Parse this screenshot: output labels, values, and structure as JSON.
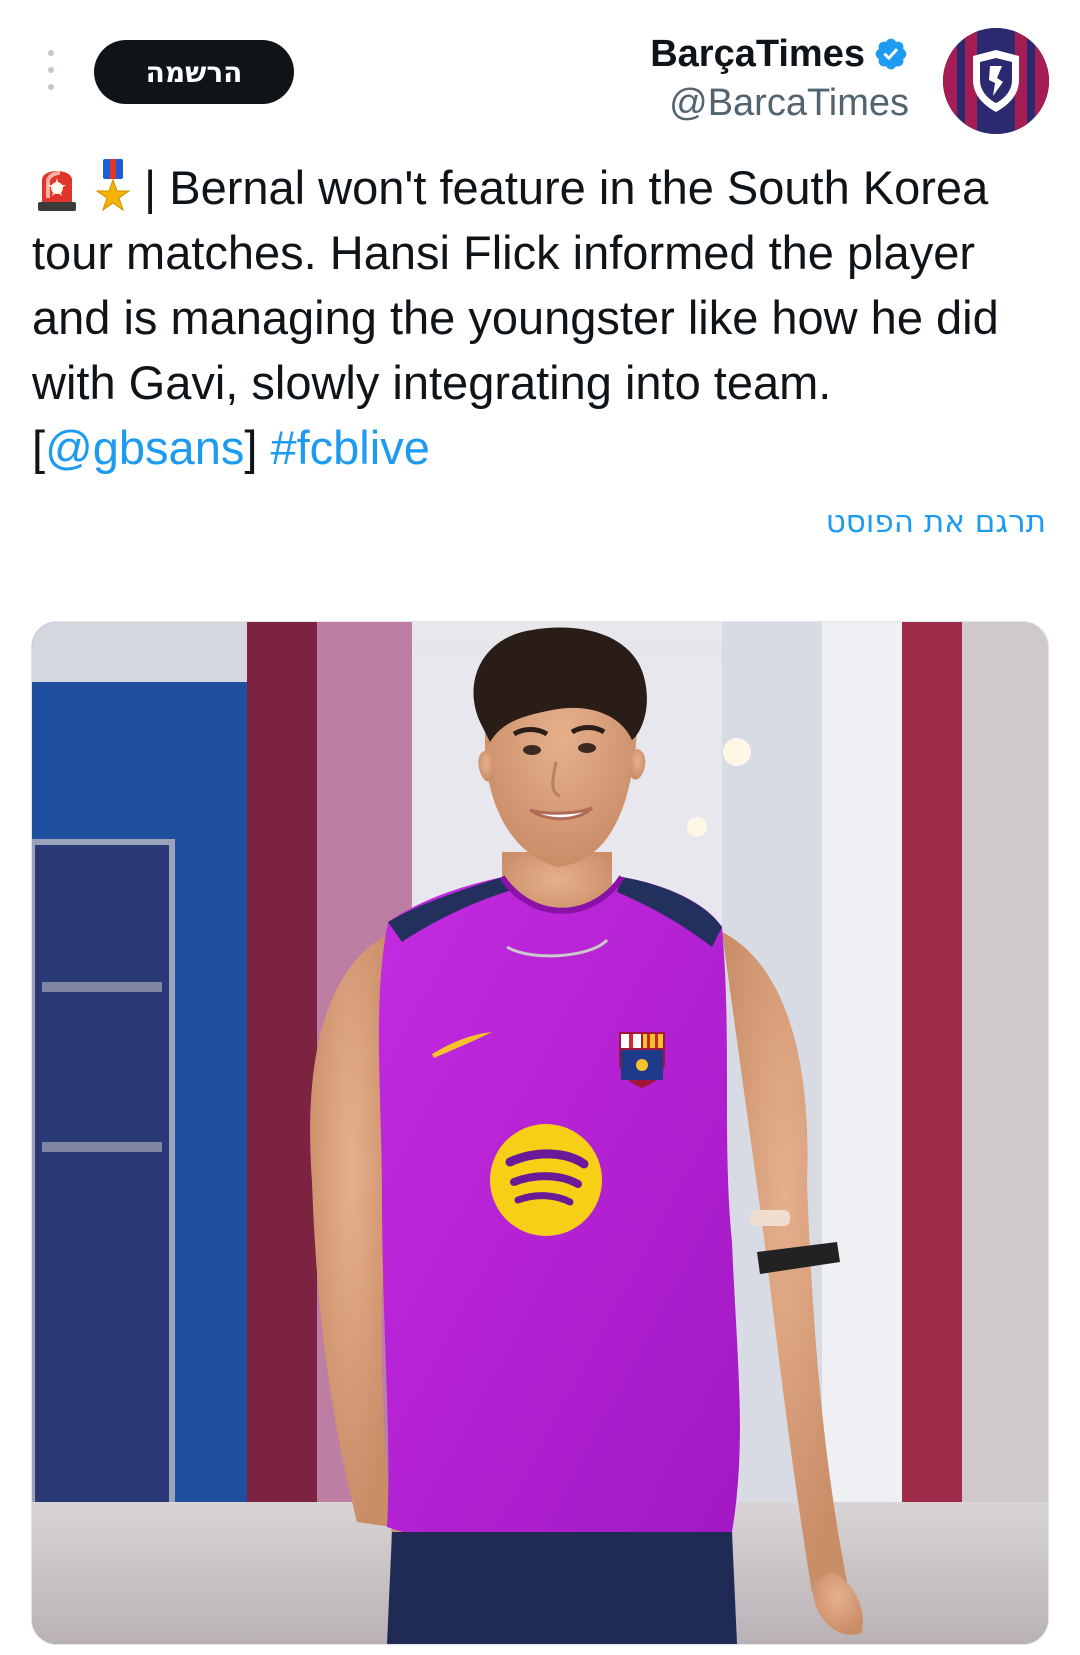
{
  "header": {
    "subscribe_label": "הרשמה",
    "more_icon": "more-vertical-icon",
    "verified_icon": "verified-badge-icon"
  },
  "author": {
    "name": "BarçaTimes",
    "handle": "@BarcaTimes"
  },
  "tweet": {
    "emojis": [
      "police-light-emoji",
      "military-medal-emoji"
    ],
    "text_before": "| Bernal won't feature in the South Korea tour matches. Hansi Flick informed the player and is managing the youngster like how he did with Gavi, slowly integrating into team. [",
    "mention": "@gbsans",
    "text_between": "] ",
    "hashtag": "#fcblive",
    "translate_label": "תרגם את הפוסט"
  },
  "colors": {
    "link": "#1d9bf0",
    "text": "#0f1419",
    "secondary": "#536471",
    "button": "#0f1419",
    "jersey": "#b61fd6"
  }
}
